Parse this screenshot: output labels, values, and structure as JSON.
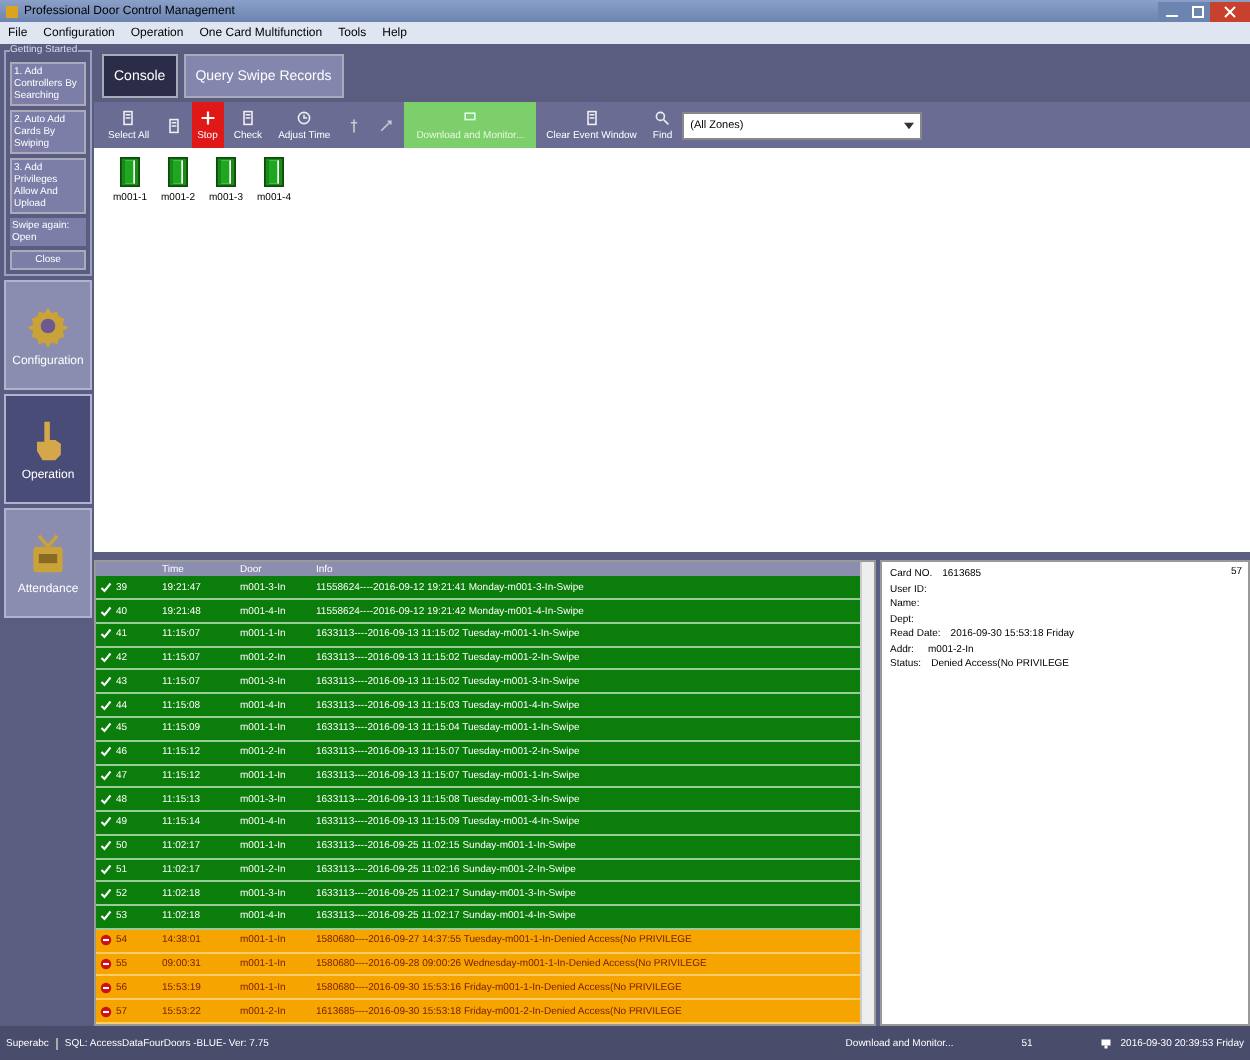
{
  "window": {
    "title": "Professional Door Control Management"
  },
  "menu": [
    "File",
    "Configuration",
    "Operation",
    "One Card Multifunction",
    "Tools",
    "Help"
  ],
  "getting_started": {
    "title": "Getting Started",
    "steps": [
      "1. Add Controllers By Searching",
      "2. Auto Add Cards By Swiping",
      "3. Add Privileges Allow And Upload"
    ],
    "swipe_note": "Swipe again: Open",
    "close": "Close"
  },
  "nav": [
    {
      "label": "Configuration",
      "kind": "gear",
      "selected": false
    },
    {
      "label": "Operation",
      "kind": "hand",
      "selected": true
    },
    {
      "label": "Attendance",
      "kind": "badge",
      "selected": false
    }
  ],
  "tabs": [
    {
      "label": "Console",
      "selected": true
    },
    {
      "label": "Query Swipe Records",
      "selected": false
    }
  ],
  "toolbar": [
    {
      "label": "Select All",
      "kind": "list",
      "active": false
    },
    {
      "kind": "doc",
      "active": false
    },
    {
      "label": "Stop",
      "kind": "stop",
      "active": true
    },
    {
      "label": "Check",
      "kind": "check",
      "active": false
    },
    {
      "label": "Adjust Time",
      "kind": "clock",
      "active": false
    },
    {
      "kind": "pin",
      "active": false
    },
    {
      "kind": "expand",
      "active": false
    },
    {
      "label": "Download and Monitor...",
      "kind": "monitor",
      "active": true
    },
    {
      "label": "Clear Event Window",
      "kind": "trash",
      "active": false
    },
    {
      "label": "Find",
      "kind": "search",
      "active": false
    }
  ],
  "zone_select": {
    "value": "(All Zones)"
  },
  "doors": [
    "m001-1",
    "m001-2",
    "m001-3",
    "m001-4"
  ],
  "log": {
    "columns": [
      "Time",
      "Door",
      "Info"
    ],
    "rows": [
      {
        "id": "39",
        "time": "19:21:47",
        "door": "m001-3-In",
        "info": "11558624----2016-09-12 19:21:41 Monday-m001-3-In-Swipe",
        "kind": "granted"
      },
      {
        "id": "40",
        "time": "19:21:48",
        "door": "m001-4-In",
        "info": "11558624----2016-09-12 19:21:42 Monday-m001-4-In-Swipe",
        "kind": "granted"
      },
      {
        "id": "41",
        "time": "11:15:07",
        "door": "m001-1-In",
        "info": "1633113----2016-09-13 11:15:02 Tuesday-m001-1-In-Swipe",
        "kind": "granted"
      },
      {
        "id": "42",
        "time": "11:15:07",
        "door": "m001-2-In",
        "info": "1633113----2016-09-13 11:15:02 Tuesday-m001-2-In-Swipe",
        "kind": "granted"
      },
      {
        "id": "43",
        "time": "11:15:07",
        "door": "m001-3-In",
        "info": "1633113----2016-09-13 11:15:02 Tuesday-m001-3-In-Swipe",
        "kind": "granted"
      },
      {
        "id": "44",
        "time": "11:15:08",
        "door": "m001-4-In",
        "info": "1633113----2016-09-13 11:15:03 Tuesday-m001-4-In-Swipe",
        "kind": "granted"
      },
      {
        "id": "45",
        "time": "11:15:09",
        "door": "m001-1-In",
        "info": "1633113----2016-09-13 11:15:04 Tuesday-m001-1-In-Swipe",
        "kind": "granted"
      },
      {
        "id": "46",
        "time": "11:15:12",
        "door": "m001-2-In",
        "info": "1633113----2016-09-13 11:15:07 Tuesday-m001-2-In-Swipe",
        "kind": "granted"
      },
      {
        "id": "47",
        "time": "11:15:12",
        "door": "m001-1-In",
        "info": "1633113----2016-09-13 11:15:07 Tuesday-m001-1-In-Swipe",
        "kind": "granted"
      },
      {
        "id": "48",
        "time": "11:15:13",
        "door": "m001-3-In",
        "info": "1633113----2016-09-13 11:15:08 Tuesday-m001-3-In-Swipe",
        "kind": "granted"
      },
      {
        "id": "49",
        "time": "11:15:14",
        "door": "m001-4-In",
        "info": "1633113----2016-09-13 11:15:09 Tuesday-m001-4-In-Swipe",
        "kind": "granted"
      },
      {
        "id": "50",
        "time": "11:02:17",
        "door": "m001-1-In",
        "info": "1633113----2016-09-25 11:02:15 Sunday-m001-1-In-Swipe",
        "kind": "granted"
      },
      {
        "id": "51",
        "time": "11:02:17",
        "door": "m001-2-In",
        "info": "1633113----2016-09-25 11:02:16 Sunday-m001-2-In-Swipe",
        "kind": "granted"
      },
      {
        "id": "52",
        "time": "11:02:18",
        "door": "m001-3-In",
        "info": "1633113----2016-09-25 11:02:17 Sunday-m001-3-In-Swipe",
        "kind": "granted"
      },
      {
        "id": "53",
        "time": "11:02:18",
        "door": "m001-4-In",
        "info": "1633113----2016-09-25 11:02:17 Sunday-m001-4-In-Swipe",
        "kind": "granted"
      },
      {
        "id": "54",
        "time": "14:38:01",
        "door": "m001-1-In",
        "info": "1580680----2016-09-27 14:37:55 Tuesday-m001-1-In-Denied Access(No PRIVILEGE",
        "kind": "denied"
      },
      {
        "id": "55",
        "time": "09:00:31",
        "door": "m001-1-In",
        "info": "1580680----2016-09-28 09:00:26 Wednesday-m001-1-In-Denied Access(No PRIVILEGE",
        "kind": "denied"
      },
      {
        "id": "56",
        "time": "15:53:19",
        "door": "m001-1-In",
        "info": "1580680----2016-09-30 15:53:16 Friday-m001-1-In-Denied Access(No PRIVILEGE",
        "kind": "denied"
      },
      {
        "id": "57",
        "time": "15:53:22",
        "door": "m001-2-In",
        "info": "1613685----2016-09-30 15:53:18 Friday-m001-2-In-Denied Access(No PRIVILEGE",
        "kind": "denied"
      }
    ]
  },
  "detail": {
    "counter": "57",
    "fields": [
      {
        "label": "Card NO.",
        "value": "1613685"
      },
      {
        "label": "User ID:"
      },
      {
        "label": "Name:"
      },
      {
        "label": "Dept:"
      },
      {
        "label": "Read Date:",
        "value": "2016-09-30 15:53:18 Friday"
      },
      {
        "label": "Addr:",
        "value": "m001-2-In"
      },
      {
        "label": "Status:",
        "value": "Denied Access(No PRIVILEGE"
      }
    ]
  },
  "status_bar": {
    "user": "Superabc",
    "database": "SQL: AccessDataFourDoors -BLUE- Ver: 7.75",
    "task": "Download and Monitor...",
    "count": "51",
    "datetime": "2016-09-30 20:39:53 Friday"
  }
}
